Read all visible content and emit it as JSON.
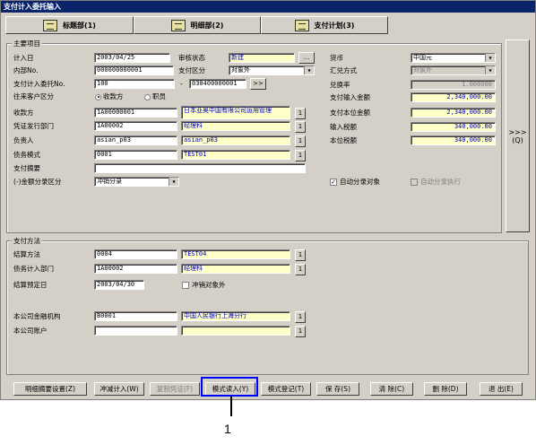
{
  "window": {
    "title": "支付计入委托输入"
  },
  "tabs": [
    {
      "label": "标题部(1)",
      "icon": "book-icon"
    },
    {
      "label": "明细部(2)",
      "icon": "ledger-icon"
    },
    {
      "label": "支付计划(3)",
      "icon": "monitor-icon"
    }
  ],
  "main_group": {
    "title": "主要项目",
    "entry_date_label": "计入日",
    "entry_date": "2003/04/25",
    "review_status_label": "审核状态",
    "review_status": "新建",
    "internal_no_label": "内部No.",
    "internal_no": "000000000001",
    "payment_class_label": "支付区分",
    "payment_class": "对象外",
    "request_no_label": "支付计入委托No.",
    "request_no": "100",
    "request_no_sep": "-",
    "request_no_suffix": "030400000001",
    "counterparty_type_label": "往来客户区分",
    "counterparty_options": [
      "收款方",
      "职员"
    ],
    "payee_label": "收款方",
    "payee_code": "1A00000001",
    "payee_name": "日本亚奥中国有限公司运用管理",
    "voucher_dept_label": "凭证发行部门",
    "voucher_dept_code": "1A00002",
    "voucher_dept_name": "经理科",
    "person_label": "负责人",
    "person_code": "asian_p03",
    "person_name": "asian_p03",
    "debt_mode_label": "债务模式",
    "debt_mode_code": "0001",
    "debt_mode_name": "TEST01",
    "summary_label": "支付摘要",
    "summary": "",
    "amount_class_label": "(-)金额分录区分",
    "amount_class": "冲销分录",
    "currency_label": "货币",
    "currency": "中国元",
    "rate_method_label": "汇兑方式",
    "rate_method": "对象外",
    "rate_label": "兑换率",
    "rate": "1.000000",
    "pay_amount_label": "支付输入金额",
    "pay_amount": "2,340,000.00",
    "pay_base_amount_label": "支付本位金额",
    "pay_base_amount": "2,340,000.00",
    "input_tax_label": "输入税额",
    "input_tax": "340,000.00",
    "base_tax_label": "本位税额",
    "base_tax": "340,000.00",
    "auto_entry_label": "自动分录对象",
    "auto_entry_checked": "✓",
    "auto_exec_label": "自动分录执行",
    "lookup_btn": "...",
    "range_btn": ">>",
    "small_btn": "1"
  },
  "side_button": {
    "arrows": ">>>",
    "label": "(Q)"
  },
  "payment_group": {
    "title": "支付方法",
    "settle_method_label": "结算方法",
    "settle_method_code": "0004",
    "settle_method_name": "TEST04",
    "debt_dept_label": "债务计入部门",
    "debt_dept_code": "1A00002",
    "debt_dept_name": "经理科",
    "settle_date_label": "结算预定日",
    "settle_date": "2003/04/30",
    "offset_label": "冲销对象外",
    "bank_label": "本公司金融机构",
    "bank_code": "B0001",
    "bank_name": "中国人民银行上海分行",
    "account_label": "本公司账户",
    "account_code": "",
    "account_name": ""
  },
  "buttons": [
    "明细摘要设置(Z)",
    "冲减计入(W)",
    "复制凭证(F)",
    "模式读入(Y)",
    "模式登记(T)",
    "保 存(S)",
    "清 除(C)",
    "删 除(D)",
    "退 出(E)"
  ],
  "callout": "1"
}
